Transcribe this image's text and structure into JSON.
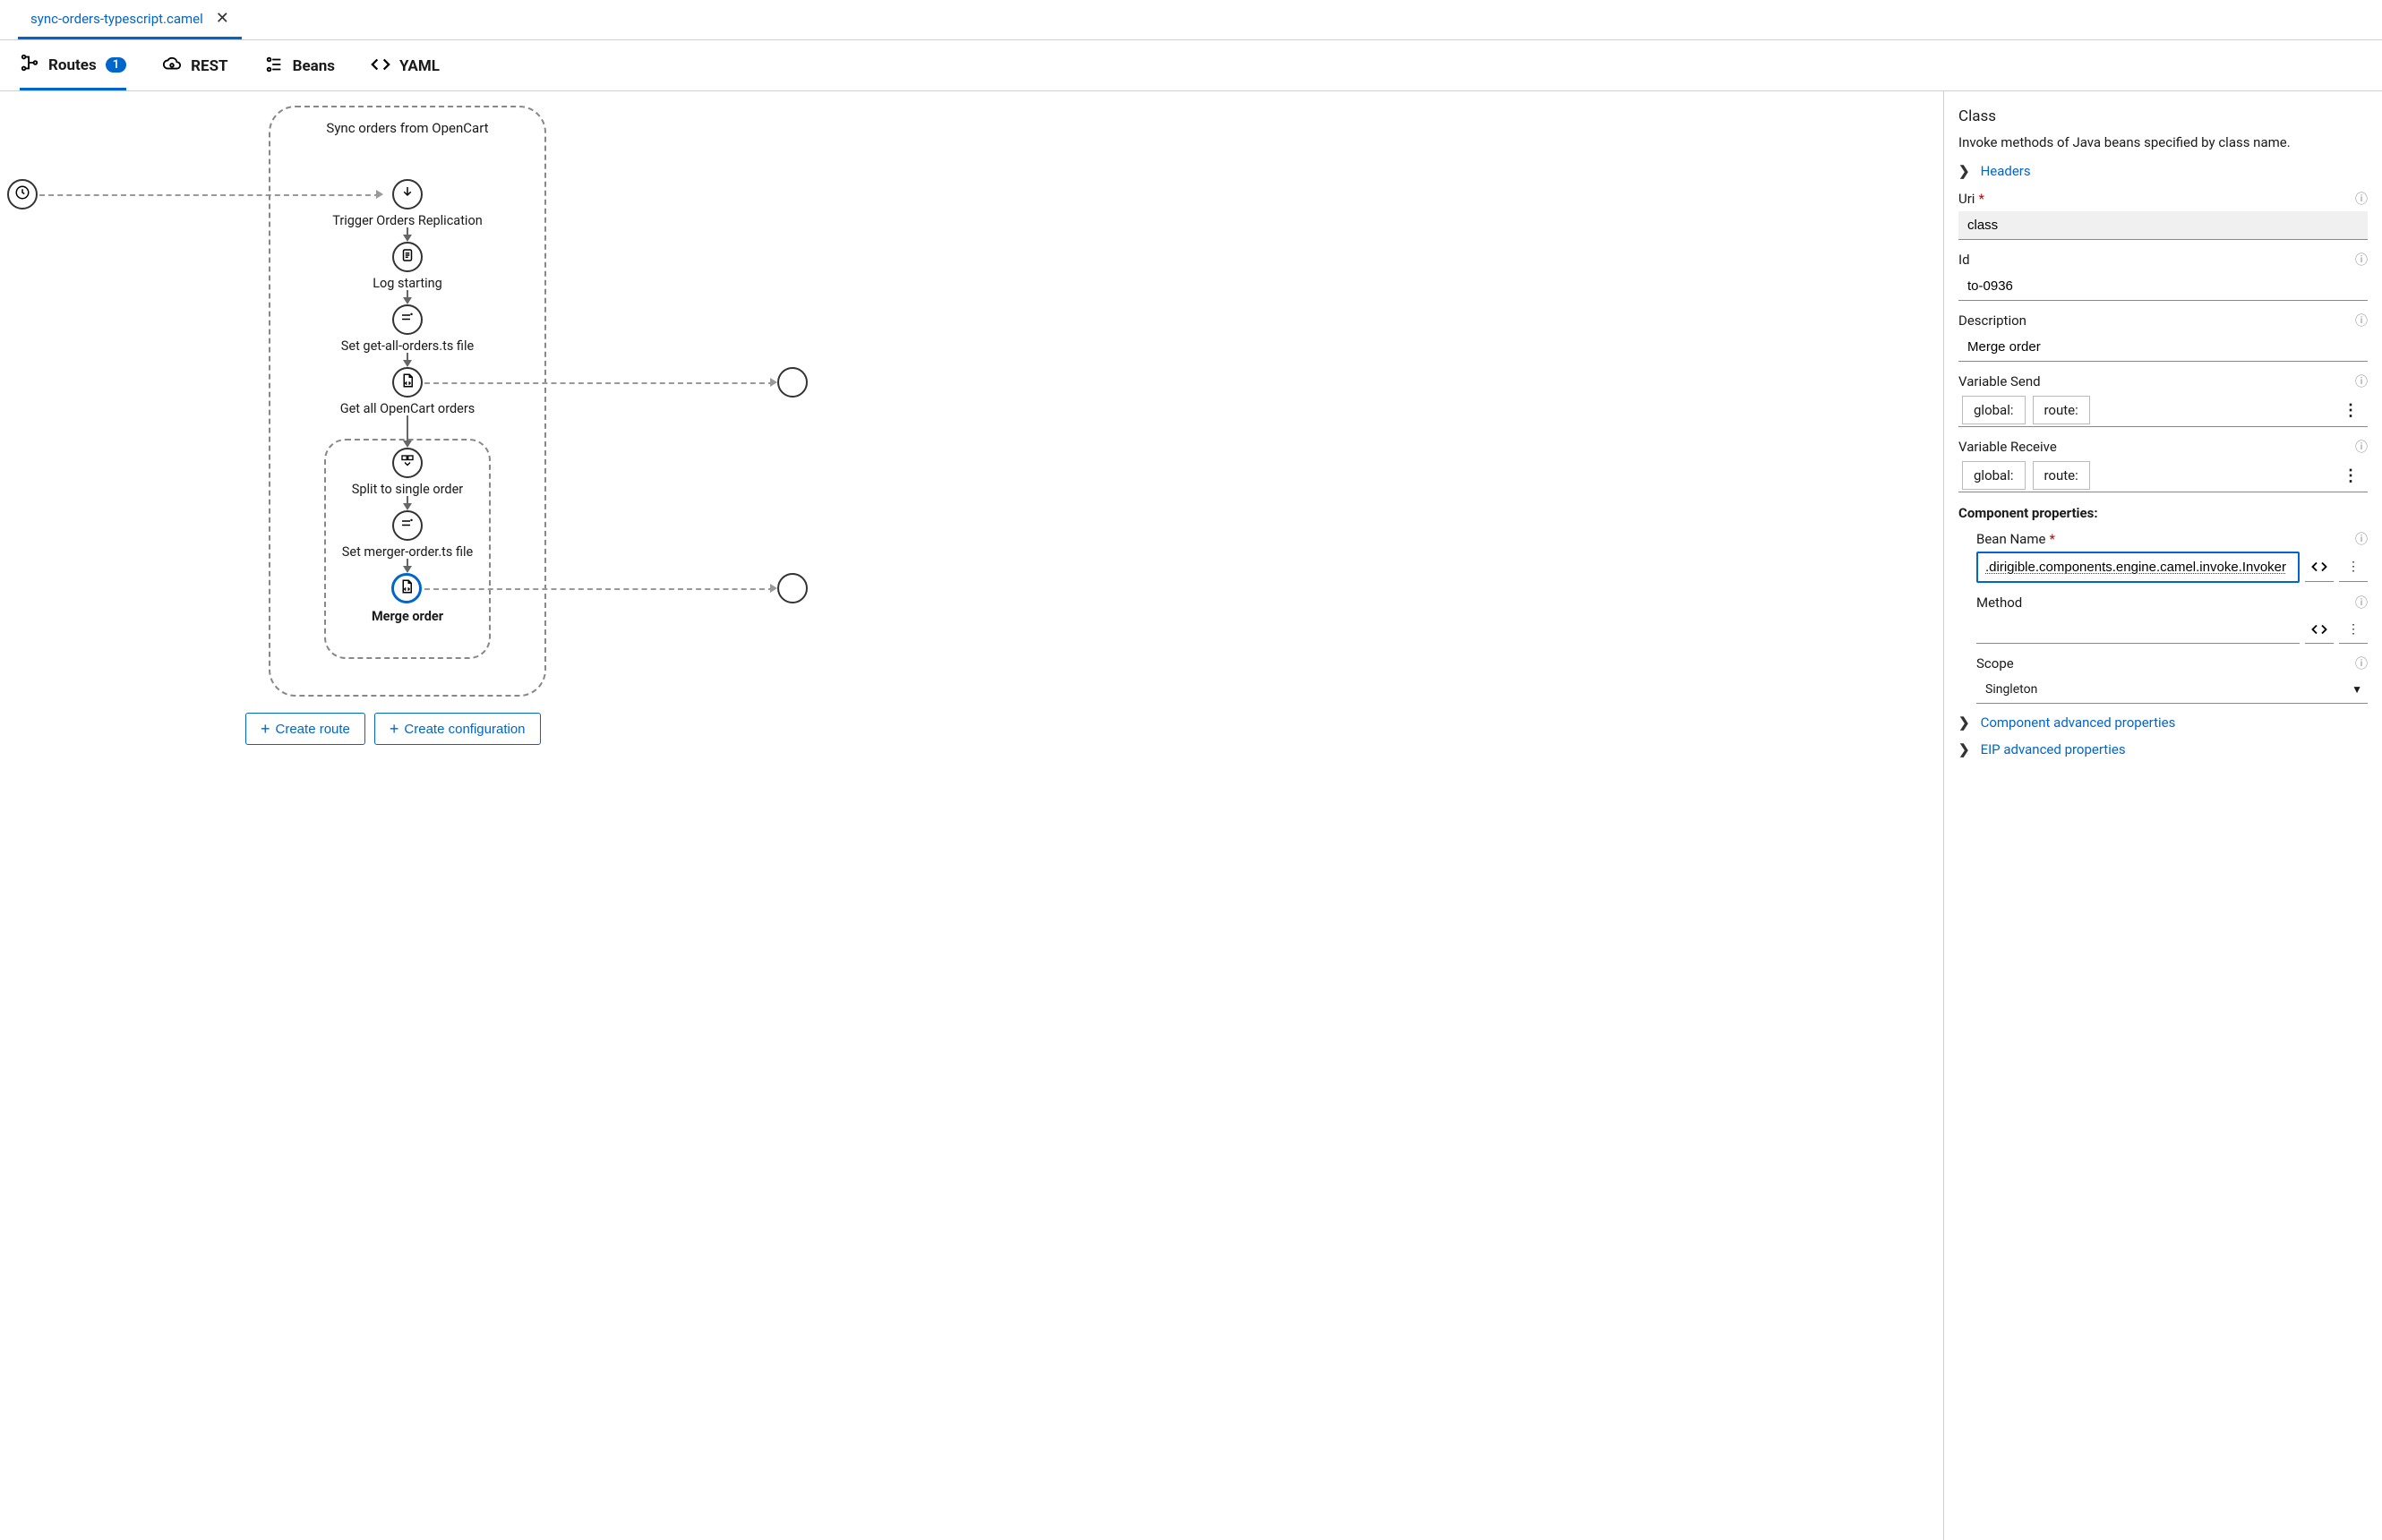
{
  "fileTab": {
    "name": "sync-orders-typescript.camel"
  },
  "toolTabs": {
    "routes": {
      "label": "Routes",
      "badge": "1"
    },
    "rest": {
      "label": "REST"
    },
    "beans": {
      "label": "Beans"
    },
    "yaml": {
      "label": "YAML"
    }
  },
  "route": {
    "title": "Sync orders from OpenCart",
    "steps": {
      "trigger": "Trigger Orders Replication",
      "log": "Log starting",
      "setGetAll": "Set get-all-orders.ts file",
      "getAll": "Get all OpenCart orders",
      "split": "Split to single order",
      "setMerger": "Set merger-order.ts file",
      "merge": "Merge order"
    }
  },
  "canvasButtons": {
    "createRoute": "Create route",
    "createConfig": "Create configuration"
  },
  "panel": {
    "title": "Class",
    "description": "Invoke methods of Java beans specified by class name.",
    "headersLabel": "Headers",
    "uri": {
      "label": "Uri",
      "value": "class"
    },
    "id": {
      "label": "Id",
      "value": "to-0936"
    },
    "descriptionField": {
      "label": "Description",
      "value": "Merge order"
    },
    "variableSend": {
      "label": "Variable Send",
      "chip1": "global:",
      "chip2": "route:"
    },
    "variableReceive": {
      "label": "Variable Receive",
      "chip1": "global:",
      "chip2": "route:"
    },
    "componentProps": "Component properties:",
    "beanName": {
      "label": "Bean Name",
      "value": ".dirigible.components.engine.camel.invoke.Invoker"
    },
    "method": {
      "label": "Method",
      "value": ""
    },
    "scope": {
      "label": "Scope",
      "value": "Singleton"
    },
    "advComponent": "Component advanced properties",
    "advEip": "EIP advanced properties"
  }
}
